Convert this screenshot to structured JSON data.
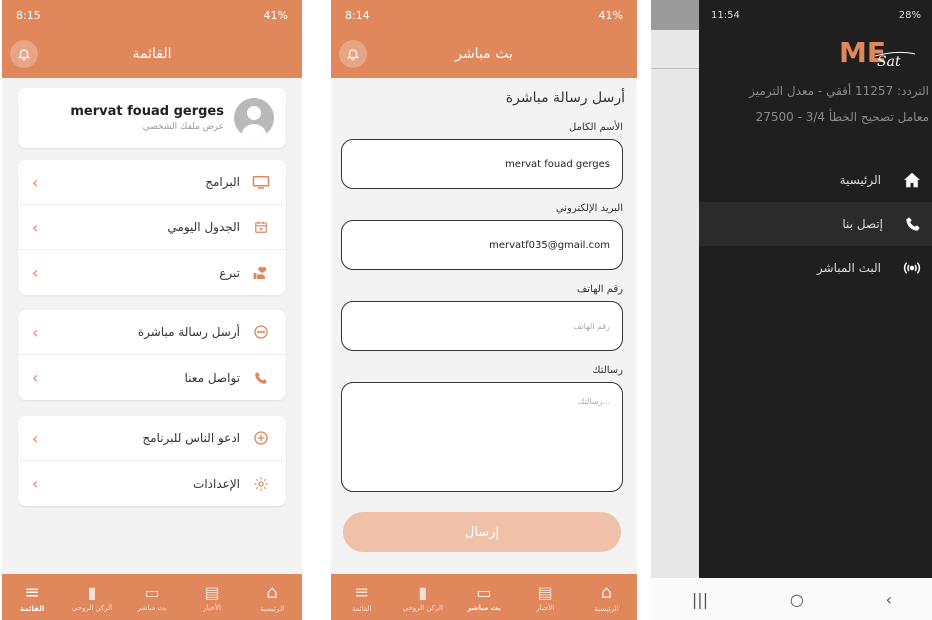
{
  "colors": {
    "accent": "#e0875c",
    "accent_light": "#f0c1a8",
    "drawer_bg": "#1f1f1f"
  },
  "panel1": {
    "status": {
      "time": "8:15",
      "battery": "41%"
    },
    "title": "القائمة",
    "profile": {
      "name": "mervat fouad gerges",
      "subtitle": "عرض ملفك الشخصي"
    },
    "groups": [
      [
        {
          "label": "البرامج",
          "icon": "tv-icon"
        },
        {
          "label": "الجدول اليومي",
          "icon": "calendar-icon"
        },
        {
          "label": "تبرع",
          "icon": "donate-icon"
        }
      ],
      [
        {
          "label": "أرسل رسالة مباشرة",
          "icon": "message-icon"
        },
        {
          "label": "تواصل معنا",
          "icon": "phone-icon"
        }
      ],
      [
        {
          "label": "ادعو الناس للبرنامج",
          "icon": "add-circle-icon"
        },
        {
          "label": "الإعدادات",
          "icon": "gear-icon"
        }
      ]
    ],
    "nav": [
      "الرئيسية",
      "الأخبار",
      "بث مباشر",
      "الركن الروحي",
      "القائمة"
    ],
    "active_nav": "القائمة"
  },
  "panel2": {
    "status": {
      "time": "8:14",
      "battery": "41%"
    },
    "title": "بث مباشر",
    "form_title": "أرسل رسالة مباشرة",
    "fields": {
      "name_label": "الأسم الكامل",
      "name_value": "mervat fouad gerges",
      "email_label": "البريد الإلكتروني",
      "email_value": "mervatf035@gmail.com",
      "phone_label": "رقم الهاتف",
      "phone_placeholder": "رقم الهاتف",
      "message_label": "رسالتك",
      "message_placeholder": "رسالتك..."
    },
    "send_label": "إرسال",
    "nav": [
      "الرئيسية",
      "الأخبار",
      "بث مباشر",
      "الركن الروحي",
      "القائمة"
    ],
    "active_nav": "بث مباشر"
  },
  "panel3": {
    "status": {
      "time": "11:54",
      "battery": "28%"
    },
    "info_line1": "التردد: 11257 أفقي - معدل الترميز",
    "info_line2": "27500 - معامل تصحيح الخطأ 3/4",
    "menu": [
      {
        "label": "الرئيسية",
        "icon": "home-icon"
      },
      {
        "label": "إتصل بنا",
        "icon": "phone-icon"
      },
      {
        "label": "البث المباشر",
        "icon": "broadcast-icon"
      }
    ],
    "sysnav": {
      "recents": "|||",
      "home": "○",
      "back": "‹"
    }
  }
}
